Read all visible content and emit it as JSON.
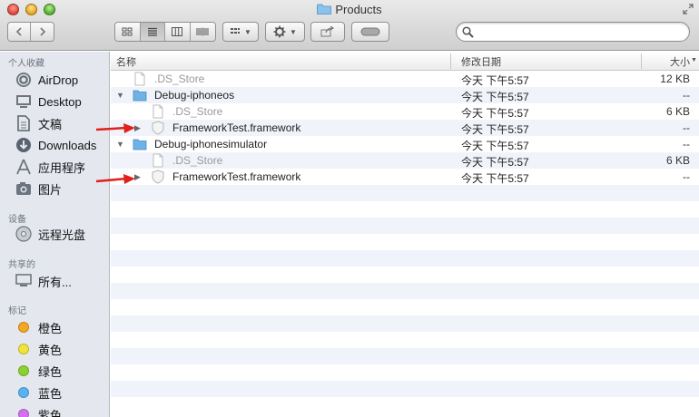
{
  "window": {
    "title": "Products"
  },
  "search": {
    "placeholder": "",
    "value": ""
  },
  "sidebar": {
    "favorites_heading": "个人收藏",
    "favorites": [
      {
        "label": "AirDrop",
        "icon": "airdrop-icon"
      },
      {
        "label": "Desktop",
        "icon": "desktop-icon"
      },
      {
        "label": "文稿",
        "icon": "documents-icon"
      },
      {
        "label": "Downloads",
        "icon": "downloads-icon"
      },
      {
        "label": "应用程序",
        "icon": "applications-icon"
      },
      {
        "label": "图片",
        "icon": "pictures-icon"
      }
    ],
    "devices_heading": "设备",
    "devices": [
      {
        "label": "远程光盘",
        "icon": "disc-icon"
      }
    ],
    "shared_heading": "共享的",
    "shared": [
      {
        "label": "所有...",
        "icon": "network-icon"
      }
    ],
    "tags_heading": "标记",
    "tags": [
      {
        "label": "橙色",
        "color": "#f5a623"
      },
      {
        "label": "黄色",
        "color": "#f2e33a"
      },
      {
        "label": "绿色",
        "color": "#8bd12f"
      },
      {
        "label": "蓝色",
        "color": "#5ab3f0"
      },
      {
        "label": "紫色",
        "color": "#d56ff0"
      }
    ]
  },
  "columns": {
    "name": "名称",
    "date": "修改日期",
    "size": "大小"
  },
  "files": [
    {
      "name": ".DS_Store",
      "date": "今天 下午5:57",
      "size": "12 KB",
      "type": "file",
      "indent": 0,
      "dim": true
    },
    {
      "name": "Debug-iphoneos",
      "date": "今天 下午5:57",
      "size": "--",
      "type": "folder",
      "indent": 0,
      "expanded": true
    },
    {
      "name": ".DS_Store",
      "date": "今天 下午5:57",
      "size": "6 KB",
      "type": "file",
      "indent": 1,
      "dim": true
    },
    {
      "name": "FrameworkTest.framework",
      "date": "今天 下午5:57",
      "size": "--",
      "type": "framework",
      "indent": 1,
      "expanded": false
    },
    {
      "name": "Debug-iphonesimulator",
      "date": "今天 下午5:57",
      "size": "--",
      "type": "folder",
      "indent": 0,
      "expanded": true
    },
    {
      "name": ".DS_Store",
      "date": "今天 下午5:57",
      "size": "6 KB",
      "type": "file",
      "indent": 1,
      "dim": true
    },
    {
      "name": "FrameworkTest.framework",
      "date": "今天 下午5:57",
      "size": "--",
      "type": "framework",
      "indent": 1,
      "expanded": false
    }
  ],
  "colors": {
    "annotation_arrow": "#e0201b",
    "sidebar_bg": "#e4e8ee",
    "folder_blue": "#6fb3e6"
  }
}
